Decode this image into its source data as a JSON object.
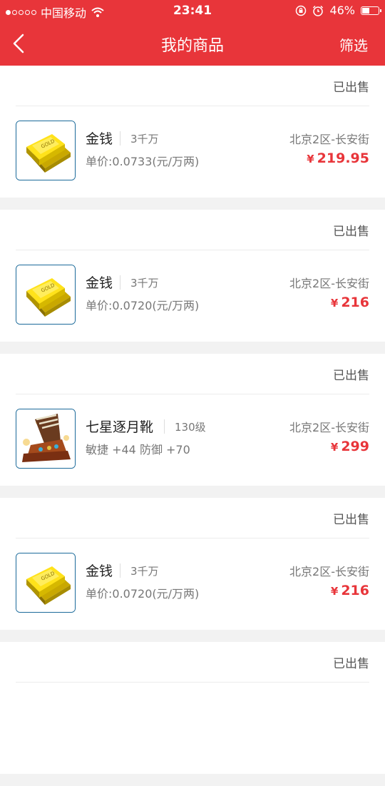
{
  "status_bar": {
    "carrier": "中国移动",
    "time": "23:41",
    "battery": "46%",
    "battery_level": 0.46
  },
  "nav": {
    "title": "我的商品",
    "filter_label": "筛选"
  },
  "currency_symbol": "¥",
  "items": [
    {
      "status": "已出售",
      "name": "金钱",
      "qty": "3千万",
      "detail": "单价:0.0733(元/万两)",
      "server": "北京2区-长安街",
      "price": "219.95",
      "icon": "gold-ingot-icon"
    },
    {
      "status": "已出售",
      "name": "金钱",
      "qty": "3千万",
      "detail": "单价:0.0720(元/万两)",
      "server": "北京2区-长安街",
      "price": "216",
      "icon": "gold-ingot-icon"
    },
    {
      "status": "已出售",
      "name": "七星逐月靴",
      "qty": "130级",
      "detail": "敏捷 +44 防御 +70",
      "server": "北京2区-长安街",
      "price": "299",
      "icon": "boots-icon"
    },
    {
      "status": "已出售",
      "name": "金钱",
      "qty": "3千万",
      "detail": "单价:0.0720(元/万两)",
      "server": "北京2区-长安街",
      "price": "216",
      "icon": "gold-ingot-icon"
    },
    {
      "status": "已出售"
    }
  ],
  "colors": {
    "brand": "#e8353a",
    "thumb_border": "#1b6a9a"
  }
}
